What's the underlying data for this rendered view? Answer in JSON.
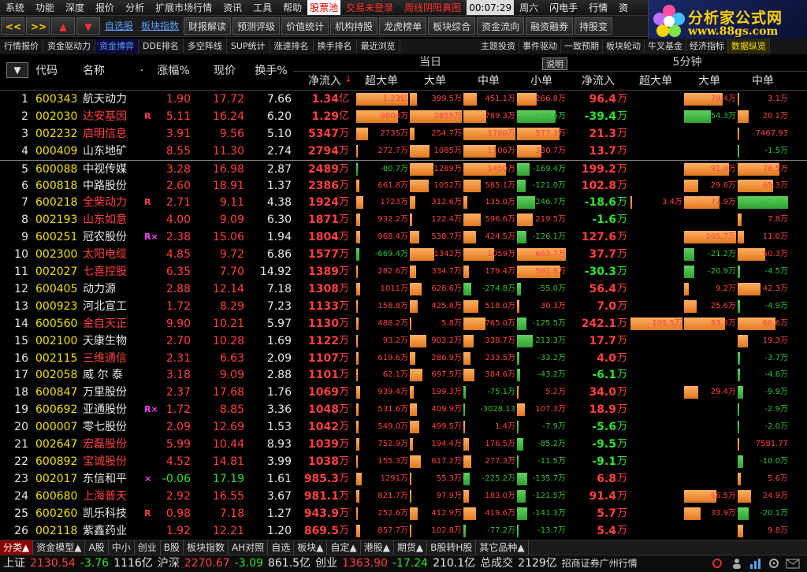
{
  "menubar": {
    "items": [
      "系统",
      "功能",
      "深度",
      "报价",
      "分析",
      "扩展市场行情",
      "资讯",
      "工具",
      "帮助"
    ],
    "ticker_label": "股票池",
    "alerts": [
      "交易未登录",
      "周线阴阳真图"
    ],
    "clock": "00:07:29",
    "weekday": "周六",
    "right_items": [
      "闪电手",
      "行情",
      "资"
    ]
  },
  "logo": {
    "title": "分析家公式网",
    "url": "www.88gs.com"
  },
  "toolbar": {
    "back": "<<",
    "forward": ">>",
    "up": "▲",
    "down": "▼",
    "links": [
      "自选股",
      "板块指数"
    ],
    "buttons": [
      "财报解读",
      "预测评级",
      "价值统计",
      "机构持股",
      "龙虎榜单",
      "板块综合",
      "资金流向",
      "融资融券",
      "持股变"
    ]
  },
  "tabs": [
    "行情报价",
    "资金驱动力",
    "资金博弈",
    "DDE排名",
    "多空阵线",
    "SUP统计",
    "涨速排名",
    "换手排名",
    "最近浏览"
  ],
  "active_tab": "资金博弈",
  "right_tabs": [
    "主题投资",
    "事件驱动",
    "一致预期",
    "板块轮动",
    "牛叉基金",
    "经济指标",
    "数据纵览"
  ],
  "header": {
    "section_day": "当日",
    "section_5min": "5分钟",
    "explain": "说明",
    "col_code": "代码",
    "col_name": "名称",
    "col_dot": "·",
    "col_chg": "涨幅%",
    "col_price": "现价",
    "col_turnover": "换手%",
    "col_net": "净流入",
    "col_super": "超大单",
    "col_big": "大单",
    "col_mid": "中单",
    "col_small": "小单",
    "col_net5": "净流入",
    "col_super5": "超大单",
    "col_big5": "大单",
    "col_mid5": "中单",
    "sort_marker": "▼"
  },
  "rows": [
    {
      "i": "1",
      "code": "600343",
      "name": "航天动力",
      "nc": "white",
      "mk": "",
      "chg": "1.90",
      "price": "17.72",
      "pc": "red",
      "turn": "7.66",
      "net": "1.34",
      "nu": "亿",
      "sup": "1.23亿",
      "big": "399.5万",
      "mid": "451.1万",
      "sml": "266.8万",
      "net5": "96.4",
      "s5": "",
      "b5": "79.4万",
      "m5": "3.1万"
    },
    {
      "i": "2",
      "code": "002030",
      "name": "达安基因",
      "nc": "red",
      "mk": "R",
      "chg": "5.11",
      "price": "16.24",
      "pc": "red",
      "turn": "6.20",
      "net": "1.29",
      "nu": "亿",
      "sup": "9804万",
      "big": "2855万",
      "mid": "789.3万",
      "sml": "-525.6万",
      "net5": "-39.4",
      "s5": "",
      "b5": "-54.3万",
      "m5": "20.1万"
    },
    {
      "i": "3",
      "code": "002232",
      "name": "启明信息",
      "nc": "red",
      "mk": "",
      "chg": "3.91",
      "price": "9.56",
      "pc": "red",
      "turn": "5.10",
      "net": "5347",
      "nu": "万",
      "sup": "2735万",
      "big": "254.7万",
      "mid": "1780万",
      "sml": "577.3万",
      "net5": "21.3",
      "s5": "",
      "b5": "",
      "m5": "7467.93"
    },
    {
      "i": "4",
      "code": "000409",
      "name": "山东地矿",
      "nc": "white",
      "mk": "",
      "chg": "8.55",
      "price": "11.30",
      "pc": "red",
      "turn": "2.74",
      "net": "2794",
      "nu": "万",
      "sup": "272.7万",
      "big": "1085万",
      "mid": "1106万",
      "sml": "330.7万",
      "net5": "13.7",
      "s5": "",
      "b5": "",
      "m5": "-1.5万"
    },
    {
      "i": "5",
      "code": "600088",
      "name": "中视传媒",
      "nc": "white",
      "mk": "",
      "chg": "3.28",
      "price": "16.98",
      "pc": "red",
      "turn": "2.87",
      "net": "2489",
      "nu": "万",
      "sup": "-80.7万",
      "big": "1289万",
      "mid": "1450万",
      "sml": "-169.4万",
      "net5": "199.2",
      "s5": "",
      "b5": "91.0万",
      "m5": "76.5万"
    },
    {
      "i": "6",
      "code": "600818",
      "name": "中路股份",
      "nc": "white",
      "mk": "",
      "chg": "2.60",
      "price": "18.91",
      "pc": "red",
      "turn": "1.37",
      "net": "2386",
      "nu": "万",
      "sup": "661.8万",
      "big": "1052万",
      "mid": "585.1万",
      "sml": "-121.0万",
      "net5": "102.8",
      "s5": "",
      "b5": "29.6万",
      "m5": "65.3万"
    },
    {
      "i": "7",
      "code": "600218",
      "name": "全柴动力",
      "nc": "red",
      "mk": "R",
      "chg": "2.71",
      "price": "9.11",
      "pc": "red",
      "turn": "4.38",
      "net": "1924",
      "nu": "万",
      "sup": "1723万",
      "big": "312.6万",
      "mid": "135.0万",
      "sml": "-246.7万",
      "net5": "-18.6",
      "s5": "3.4万",
      "b5": "71.9万",
      "m5": "-91.5万"
    },
    {
      "i": "8",
      "code": "002193",
      "name": "山东如意",
      "nc": "red",
      "mk": "",
      "chg": "4.00",
      "price": "9.09",
      "pc": "red",
      "turn": "6.30",
      "net": "1871",
      "nu": "万",
      "sup": "932.2万",
      "big": "122.4万",
      "mid": "596.6万",
      "sml": "219.5万",
      "net5": "-1.6",
      "s5": "",
      "b5": "",
      "m5": "7.8万"
    },
    {
      "i": "9",
      "code": "600251",
      "name": "冠农股份",
      "nc": "white",
      "mk": "R×",
      "chg": "2.38",
      "price": "15.06",
      "pc": "red",
      "turn": "1.94",
      "net": "1804",
      "nu": "万",
      "sup": "968.4万",
      "big": "538.7万",
      "mid": "424.5万",
      "sml": "-126.1万",
      "net5": "127.6",
      "s5": "",
      "b5": "105.7万",
      "m5": "11.0万"
    },
    {
      "i": "10",
      "code": "002300",
      "name": "太阳电缆",
      "nc": "red",
      "mk": "",
      "chg": "4.85",
      "price": "9.72",
      "pc": "red",
      "turn": "6.86",
      "net": "1577",
      "nu": "万",
      "sup": "-669.4万",
      "big": "1342万",
      "mid": "1059万",
      "sml": "663.7万",
      "net5": "37.7",
      "s5": "",
      "b5": "-21.2万",
      "m5": "50.3万"
    },
    {
      "i": "11",
      "code": "002027",
      "name": "七喜控股",
      "nc": "red",
      "mk": "",
      "chg": "6.35",
      "price": "7.70",
      "pc": "red",
      "turn": "14.92",
      "net": "1389",
      "nu": "万",
      "sup": "282.6万",
      "big": "334.7万",
      "mid": "179.4万",
      "sml": "592.8万",
      "net5": "-30.3",
      "s5": "",
      "b5": "-20.9万",
      "m5": "-4.5万"
    },
    {
      "i": "12",
      "code": "600405",
      "name": "动力源",
      "nc": "white",
      "mk": "",
      "chg": "2.88",
      "price": "12.14",
      "pc": "red",
      "turn": "7.18",
      "net": "1308",
      "nu": "万",
      "sup": "1011万",
      "big": "628.6万",
      "mid": "-274.8万",
      "sml": "-55.0万",
      "net5": "56.4",
      "s5": "",
      "b5": "9.2万",
      "m5": "42.3万"
    },
    {
      "i": "13",
      "code": "000923",
      "name": "河北宣工",
      "nc": "white",
      "mk": "",
      "chg": "1.72",
      "price": "8.29",
      "pc": "red",
      "turn": "7.23",
      "net": "1133",
      "nu": "万",
      "sup": "158.8万",
      "big": "425.8万",
      "mid": "518.0万",
      "sml": "30.3万",
      "net5": "7.0",
      "s5": "",
      "b5": "25.6万",
      "m5": "-4.9万"
    },
    {
      "i": "14",
      "code": "600560",
      "name": "金自天正",
      "nc": "red",
      "mk": "",
      "chg": "9.90",
      "price": "10.21",
      "pc": "red",
      "turn": "5.97",
      "net": "1130",
      "nu": "万",
      "sup": "488.2万",
      "big": "5.8万",
      "mid": "765.0万",
      "sml": "-125.5万",
      "net5": "242.1",
      "s5": "105.5万",
      "b5": "83.3万",
      "m5": "68.6万"
    },
    {
      "i": "15",
      "code": "002100",
      "name": "天康生物",
      "nc": "white",
      "mk": "",
      "chg": "2.70",
      "price": "10.28",
      "pc": "red",
      "turn": "1.69",
      "net": "1122",
      "nu": "万",
      "sup": "93.2万",
      "big": "903.2万",
      "mid": "338.7万",
      "sml": "-213.3万",
      "net5": "17.7",
      "s5": "",
      "b5": "",
      "m5": "19.3万"
    },
    {
      "i": "16",
      "code": "002115",
      "name": "三维通信",
      "nc": "red",
      "mk": "",
      "chg": "2.31",
      "price": "6.63",
      "pc": "red",
      "turn": "2.09",
      "net": "1107",
      "nu": "万",
      "sup": "619.6万",
      "big": "286.9万",
      "mid": "233.5万",
      "sml": "-33.2万",
      "net5": "4.0",
      "s5": "",
      "b5": "",
      "m5": "-3.7万"
    },
    {
      "i": "17",
      "code": "002058",
      "name": "威 尔 泰",
      "nc": "white",
      "mk": "",
      "chg": "3.18",
      "price": "9.09",
      "pc": "red",
      "turn": "2.88",
      "net": "1101",
      "nu": "万",
      "sup": "62.1万",
      "big": "697.5万",
      "mid": "384.6万",
      "sml": "-43.2万",
      "net5": "-6.1",
      "s5": "",
      "b5": "",
      "m5": "-4.6万"
    },
    {
      "i": "18",
      "code": "600847",
      "name": "万里股份",
      "nc": "white",
      "mk": "",
      "chg": "2.37",
      "price": "17.68",
      "pc": "red",
      "turn": "1.76",
      "net": "1069",
      "nu": "万",
      "sup": "939.4万",
      "big": "199.3万",
      "mid": "-75.1万",
      "sml": "5.2万",
      "net5": "34.0",
      "s5": "",
      "b5": "29.4万",
      "m5": "-9.9万"
    },
    {
      "i": "19",
      "code": "600692",
      "name": "亚通股份",
      "nc": "white",
      "mk": "R×",
      "chg": "1.72",
      "price": "8.85",
      "pc": "red",
      "turn": "3.36",
      "net": "1048",
      "nu": "万",
      "sup": "531.6万",
      "big": "409.9万",
      "mid": "-3028.13",
      "sml": "107.3万",
      "net5": "18.9",
      "s5": "",
      "b5": "",
      "m5": "-2.9万"
    },
    {
      "i": "20",
      "code": "000007",
      "name": "零七股份",
      "nc": "white",
      "mk": "",
      "chg": "2.09",
      "price": "12.69",
      "pc": "red",
      "turn": "1.53",
      "net": "1042",
      "nu": "万",
      "sup": "549.0万",
      "big": "499.5万",
      "mid": "1.4万",
      "sml": "-7.9万",
      "net5": "-5.6",
      "s5": "",
      "b5": "",
      "m5": "-2.0万"
    },
    {
      "i": "21",
      "code": "002647",
      "name": "宏磊股份",
      "nc": "red",
      "mk": "",
      "chg": "5.99",
      "price": "10.44",
      "pc": "red",
      "turn": "8.93",
      "net": "1039",
      "nu": "万",
      "sup": "752.9万",
      "big": "194.4万",
      "mid": "176.5万",
      "sml": "-85.2万",
      "net5": "-9.5",
      "s5": "",
      "b5": "",
      "m5": "7581.77"
    },
    {
      "i": "22",
      "code": "600892",
      "name": "宝诚股份",
      "nc": "red",
      "mk": "",
      "chg": "4.52",
      "price": "14.81",
      "pc": "red",
      "turn": "3.99",
      "net": "1038",
      "nu": "万",
      "sup": "155.3万",
      "big": "617.2万",
      "mid": "277.3万",
      "sml": "-11.5万",
      "net5": "-9.1",
      "s5": "",
      "b5": "",
      "m5": "-10.0万"
    },
    {
      "i": "23",
      "code": "002017",
      "name": "东信和平",
      "nc": "white",
      "mk": "×",
      "chg": "-0.06",
      "price": "17.19",
      "pc": "green",
      "turn": "1.61",
      "net": "985.3",
      "nu": "万",
      "sup": "1291万",
      "big": "55.3万",
      "mid": "-225.2万",
      "sml": "-135.7万",
      "net5": "6.8",
      "s5": "",
      "b5": "",
      "m5": "5.6万"
    },
    {
      "i": "24",
      "code": "600680",
      "name": "上海普天",
      "nc": "red",
      "mk": "",
      "chg": "2.92",
      "price": "16.55",
      "pc": "red",
      "turn": "3.67",
      "net": "981.1",
      "nu": "万",
      "sup": "821.7万",
      "big": "97.9万",
      "mid": "183.0万",
      "sml": "-121.5万",
      "net5": "91.4",
      "s5": "",
      "b5": "66.5万",
      "m5": "24.9万"
    },
    {
      "i": "25",
      "code": "600260",
      "name": "凯乐科技",
      "nc": "white",
      "mk": "R",
      "chg": "0.98",
      "price": "7.18",
      "pc": "red",
      "turn": "1.27",
      "net": "943.9",
      "nu": "万",
      "sup": "252.6万",
      "big": "412.9万",
      "mid": "419.6万",
      "sml": "-141.3万",
      "net5": "5.7",
      "s5": "",
      "b5": "33.9万",
      "m5": "-20.1万"
    },
    {
      "i": "26",
      "code": "002118",
      "name": "紫鑫药业",
      "nc": "white",
      "mk": "",
      "chg": "1.92",
      "price": "12.21",
      "pc": "red",
      "turn": "1.20",
      "net": "869.5",
      "nu": "万",
      "sup": "857.7万",
      "big": "102.8万",
      "mid": "-77.2万",
      "sml": "-13.7万",
      "net5": "5.4",
      "s5": "",
      "b5": "",
      "m5": "9.8万"
    }
  ],
  "sheet_tabs": [
    "分类▲",
    "资金模型▲",
    "A股",
    "中小",
    "创业",
    "B股",
    "板块指数",
    "AH对照",
    "自选",
    "板块▲",
    "自定▲",
    "港股▲",
    "期货▲",
    "B股转H股",
    "其它品种▲"
  ],
  "statusbar": {
    "sh_label": "上证",
    "sh_val": "2130.54",
    "sh_chg": "-3.76",
    "sh_amt": "1116亿",
    "hs_label": "沪深",
    "hs_val": "2270.67",
    "hs_chg": "-3.09",
    "hs_amt": "861.5亿",
    "cy_label": "创业",
    "cy_val": "1363.90",
    "cy_chg": "-17.24",
    "cy_amt": "210.1亿",
    "total_label": "总成交",
    "total_amt": "2129亿",
    "broker": "招商证券广州行情"
  },
  "colors": {
    "up": "#ff4040",
    "down": "#30e030",
    "bar_up": "#f09840",
    "bar_down": "#40c040",
    "accent": "#5aa0ff",
    "logo_gold": "#ffd400"
  }
}
